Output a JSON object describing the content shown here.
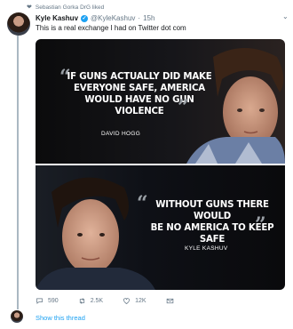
{
  "liked_by": "Sebastian Gorka DrG liked",
  "tweet": {
    "name": "Kyle Kashuv",
    "handle": "@KyleKashuv",
    "separator": "·",
    "time": "15h",
    "text": "This is a real exchange I had on Twitter dot com"
  },
  "image1": {
    "quote": [
      "IF GUNS ACTUALLY DID MAKE",
      "EVERYONE SAFE, AMERICA",
      "WOULD HAVE NO GUN VIOLENCE"
    ],
    "caption": "DAVID HOGG"
  },
  "image2": {
    "quote": [
      "WITHOUT GUNS THERE WOULD",
      "BE NO AMERICA TO KEEP SAFE"
    ],
    "caption": "KYLE KASHUV"
  },
  "actions": {
    "replies": "590",
    "retweets": "2.5K",
    "likes": "12K"
  },
  "show_thread": "Show this thread",
  "colors": {
    "link": "#1da1f2",
    "muted": "#657786"
  }
}
